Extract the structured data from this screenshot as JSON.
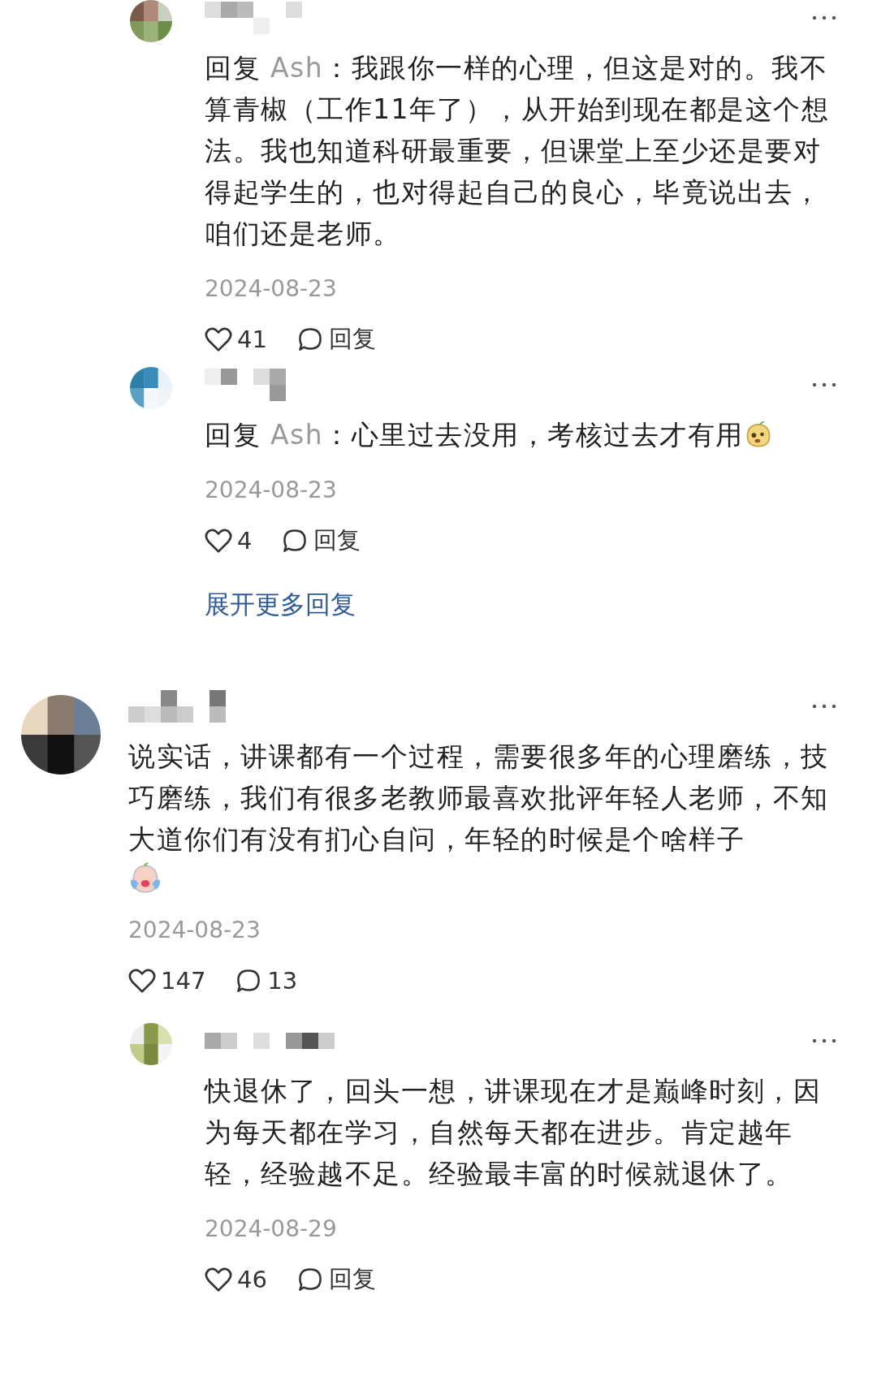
{
  "items": [
    {
      "kind": "reply",
      "reply_prefix": "回复 ",
      "reply_to": "Ash",
      "text": "：我跟你一样的心理，但这是对的。我不算青椒（工作11年了），从开始到现在都是这个想法。我也知道科研最重要，但课堂上至少还是要对得起学生的，也对得起自己的良心，毕竟说出去，咱们还是老师。",
      "date": "2024-08-23",
      "likes": "41",
      "second_action": "回复"
    },
    {
      "kind": "reply",
      "reply_prefix": "回复 ",
      "reply_to": "Ash",
      "text": "：心里过去没用，考核过去才有用",
      "emoji": {
        "kind": "smug"
      },
      "date": "2024-08-23",
      "likes": "4",
      "second_action": "回复"
    },
    {
      "kind": "more_link",
      "text": "展开更多回复"
    },
    {
      "kind": "comment",
      "text": "说实话，讲课都有一个过程，需要很多年的心理磨练，技巧磨练，我们有很多老教师最喜欢批评年轻人老师，不知大道你们有没有扪心自问，年轻的时候是个啥样子",
      "emoji": {
        "kind": "crying"
      },
      "date": "2024-08-23",
      "likes": "147",
      "second_action": "13"
    },
    {
      "kind": "reply",
      "text": "快退休了，回头一想，讲课现在才是巅峰时刻，因为每天都在学习，自然每天都在进步。肯定越年轻，经验越不足。经验最丰富的时候就退休了。",
      "date": "2024-08-29",
      "likes": "46",
      "second_action": "回复"
    }
  ]
}
